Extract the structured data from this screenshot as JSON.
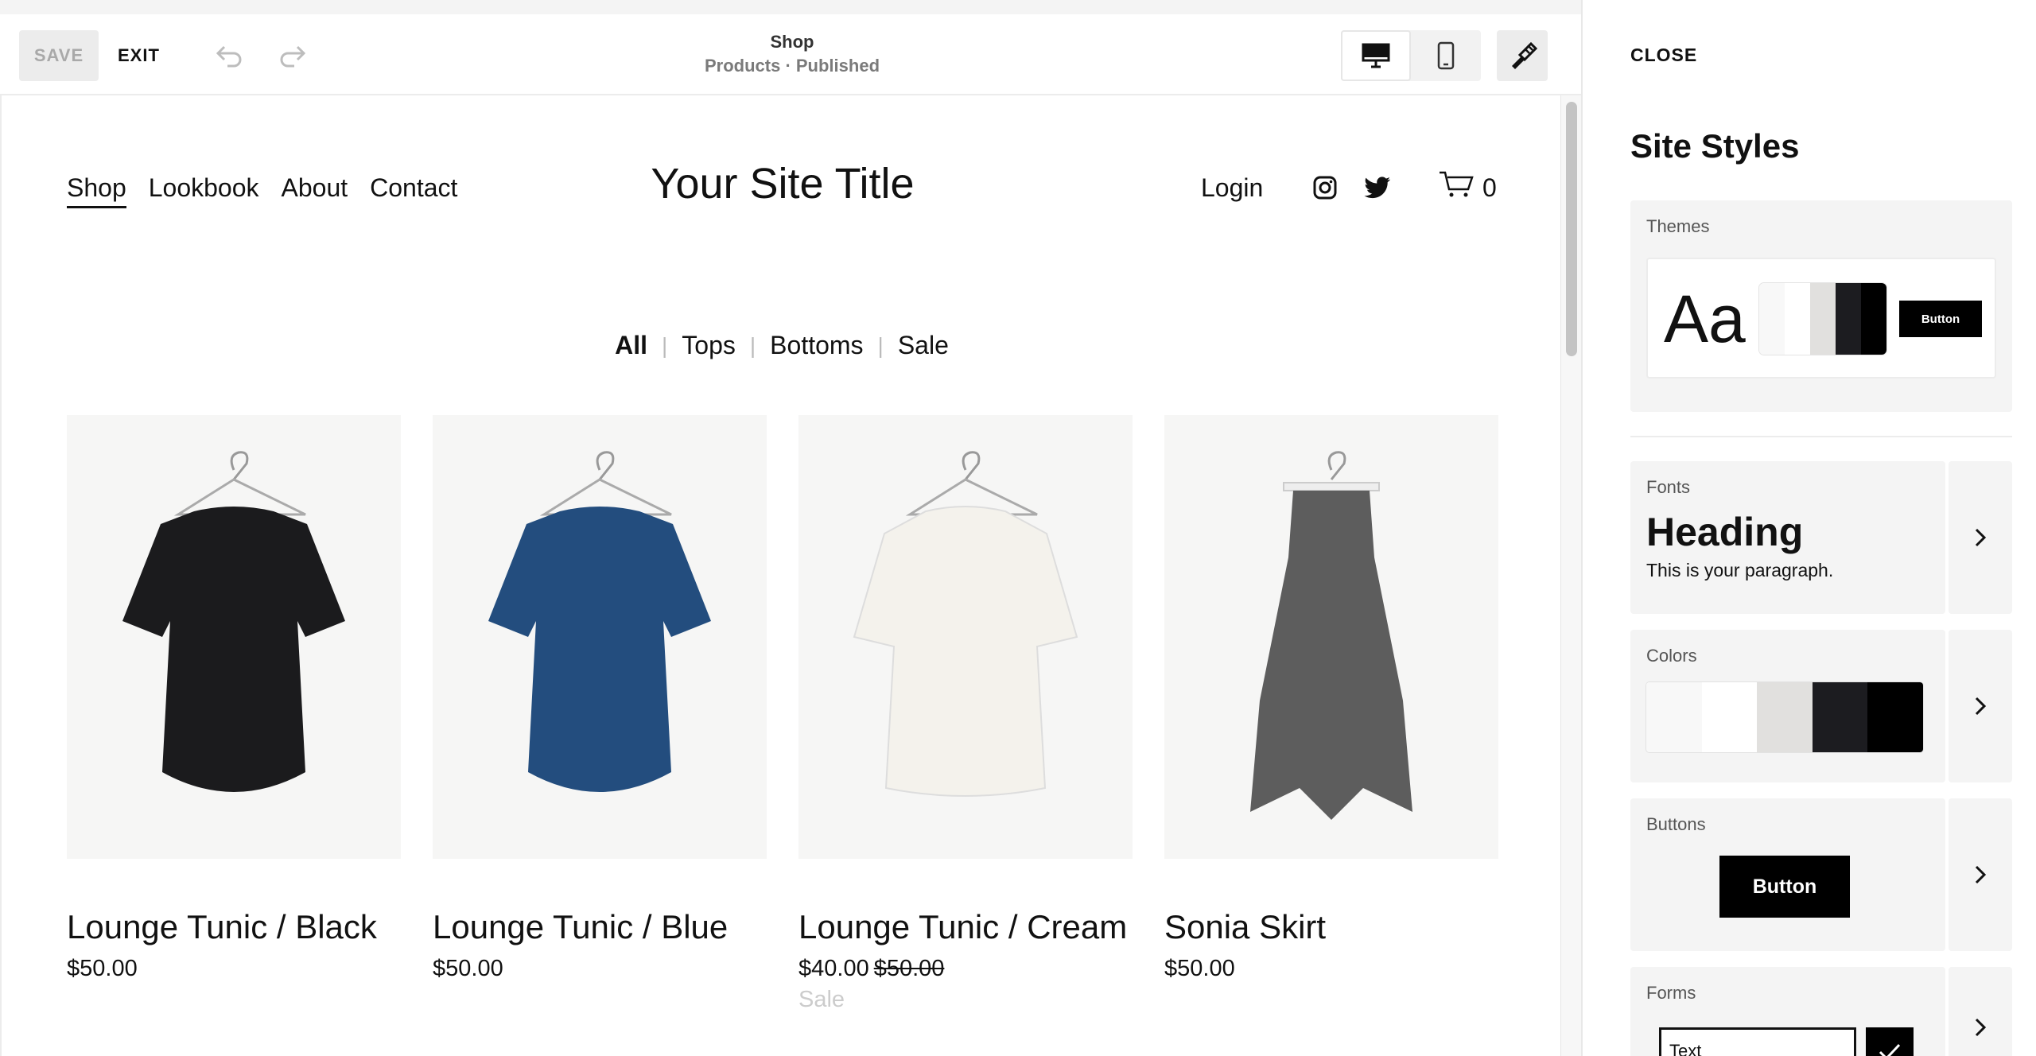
{
  "toolbar": {
    "save_label": "SAVE",
    "exit_label": "EXIT",
    "page_title": "Shop",
    "page_subtitle": "Products · Published",
    "undo_icon": "undo-icon",
    "redo_icon": "redo-icon",
    "desktop_icon": "desktop-icon",
    "mobile_icon": "mobile-icon",
    "style_icon": "paintbrush-icon"
  },
  "site": {
    "nav": [
      "Shop",
      "Lookbook",
      "About",
      "Contact"
    ],
    "title": "Your Site Title",
    "login_label": "Login",
    "cart_count": "0",
    "filters": [
      "All",
      "Tops",
      "Bottoms",
      "Sale"
    ],
    "products": [
      {
        "name": "Lounge Tunic / Black",
        "price": "$50.00",
        "color": "#1b1b1d"
      },
      {
        "name": "Lounge Tunic / Blue",
        "price": "$50.00",
        "color": "#234d7e"
      },
      {
        "name": "Lounge Tunic / Cream",
        "price": "$40.00",
        "old_price": "$50.00",
        "badge": "Sale",
        "color": "#f4f2ec"
      },
      {
        "name": "Sonia Skirt",
        "price": "$50.00",
        "color": "#5d5d5d"
      }
    ]
  },
  "panel": {
    "close_label": "CLOSE",
    "title": "Site Styles",
    "themes": {
      "label": "Themes",
      "sample": "Aa",
      "button_label": "Button"
    },
    "fonts": {
      "label": "Fonts",
      "heading": "Heading",
      "paragraph": "This is your paragraph."
    },
    "colors": {
      "label": "Colors",
      "palette": [
        "#f8f8f8",
        "#ffffff",
        "#e1e0de",
        "#1c1c20",
        "#000000"
      ]
    },
    "buttons": {
      "label": "Buttons",
      "button_label": "Button"
    },
    "forms": {
      "label": "Forms",
      "field_text": "Text"
    }
  }
}
